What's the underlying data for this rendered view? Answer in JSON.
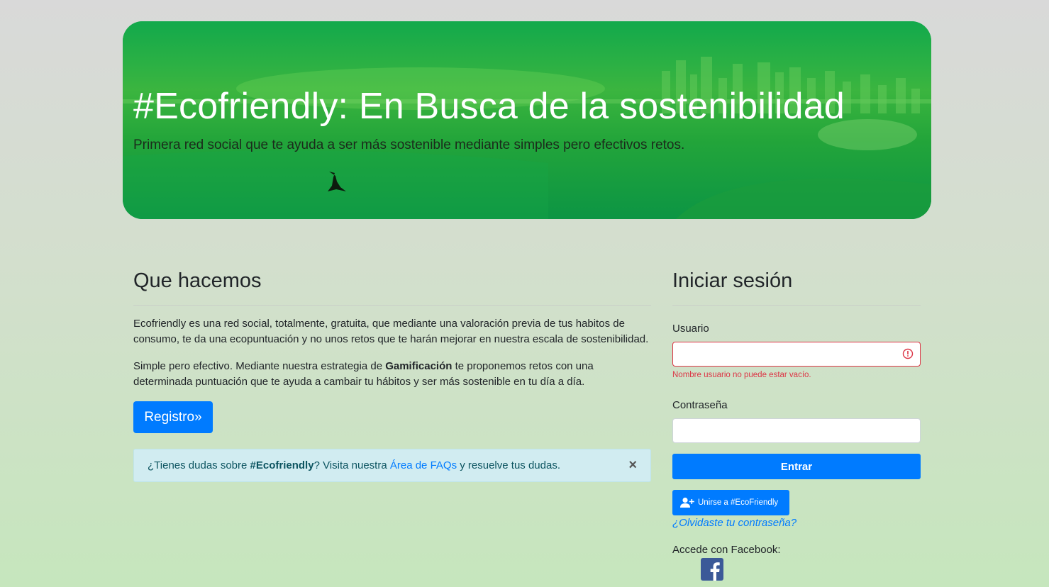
{
  "hero": {
    "title": "#Ecofriendly: En Busca de la sostenibilidad",
    "subtitle": "Primera red social que te ayuda a ser más sostenible mediante simples pero efectivos retos."
  },
  "about": {
    "title": "Que hacemos",
    "paragraph1": "Ecofriendly es una red social, totalmente, gratuita, que mediante una valoración previa de tus habitos de consumo, te da una ecopuntuación y no unos retos que te harán mejorar en nuestra escala de sostenibilidad.",
    "paragraph2_before": "Simple pero efectivo. Mediante nuestra estrategia de ",
    "paragraph2_bold": "Gamificación",
    "paragraph2_after": " te proponemos retos con una determinada puntuación que te ayuda a cambair tu hábitos y ser más sostenible en tu día a día.",
    "register_button": "Registro»"
  },
  "alert": {
    "text_before": "¿Tienes dudas sobre ",
    "brand": "#Ecofriendly",
    "text_middle": "? Visita nuestra ",
    "link": "Área de FAQs",
    "text_after": " y resuelve tus dudas.",
    "close": "×"
  },
  "login": {
    "title": "Iniciar sesión",
    "user_label": "Usuario",
    "user_value": "",
    "user_error": "Nombre usuario no puede estar vacío.",
    "password_label": "Contraseña",
    "password_value": "",
    "submit": "Entrar",
    "join_button": "Unirse a #EcoFriendly",
    "forgot": "¿Olvidaste tu contraseña?",
    "facebook_label": "Accede con Facebook:"
  },
  "colors": {
    "primary": "#007bff",
    "danger": "#dc3545",
    "alert_bg": "#d1ecf1",
    "hero_green": "#1fa845",
    "facebook": "#3b5998"
  },
  "icons": {
    "user_plus": "user-plus-icon",
    "error": "exclamation-circle-icon",
    "close": "close-icon",
    "facebook": "facebook-icon"
  }
}
